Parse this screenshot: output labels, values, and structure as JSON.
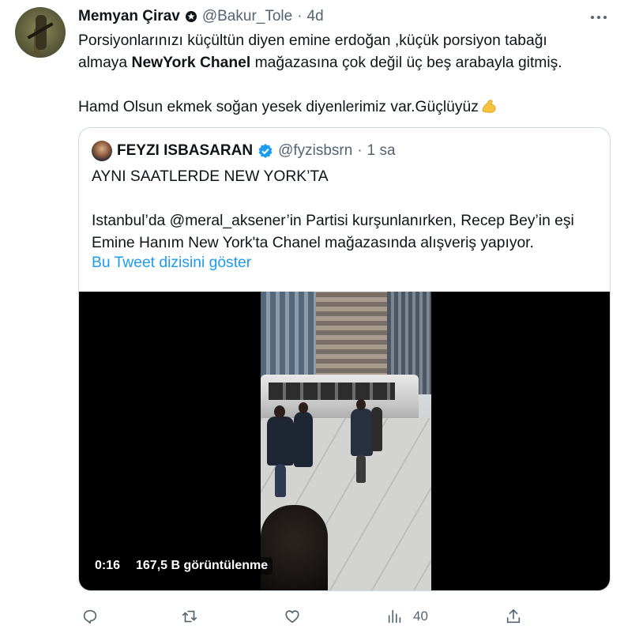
{
  "tweet": {
    "author_name": "Memyan Çirav",
    "handle": "@Bakur_Tole",
    "time": "4d",
    "text_line1": "Porsiyonlarınızı küçültün diyen emine erdoğan ,küçük porsiyon tabağı",
    "text_line2_prefix": "almaya ",
    "text_line2_bold": "NewYork Chanel",
    "text_line2_suffix": " mağazasına çok değil üç beş arabayla gitmiş.",
    "text_line3": "Hamd Olsun ekmek soğan yesek diyenlerimiz var.Güçlüyüz"
  },
  "quoted": {
    "author_name": "FEYZI ISBASARAN",
    "handle": "@fyzisbsrn",
    "time": "1 sa",
    "line1": "AYNI SAATLERDE NEW YORK’TA",
    "line2": "Istanbul’da @meral_aksener’in Partisi kurşunlanırken, Recep Bey’in eşi",
    "line3": "Emine Hanım New York'ta Chanel mağazasında alışveriş yapıyor.",
    "show_thread": "Bu Tweet dizisini göster",
    "video": {
      "duration": "0:16",
      "views": "167,5 B görüntülenme"
    }
  },
  "actions": {
    "reply_count": "",
    "retweet_count": "",
    "like_count": "",
    "views_count": "40",
    "share_count": ""
  },
  "colors": {
    "text": "#0f1419",
    "muted": "#536471",
    "link": "#1d9bf0",
    "border": "#cfd9de"
  }
}
